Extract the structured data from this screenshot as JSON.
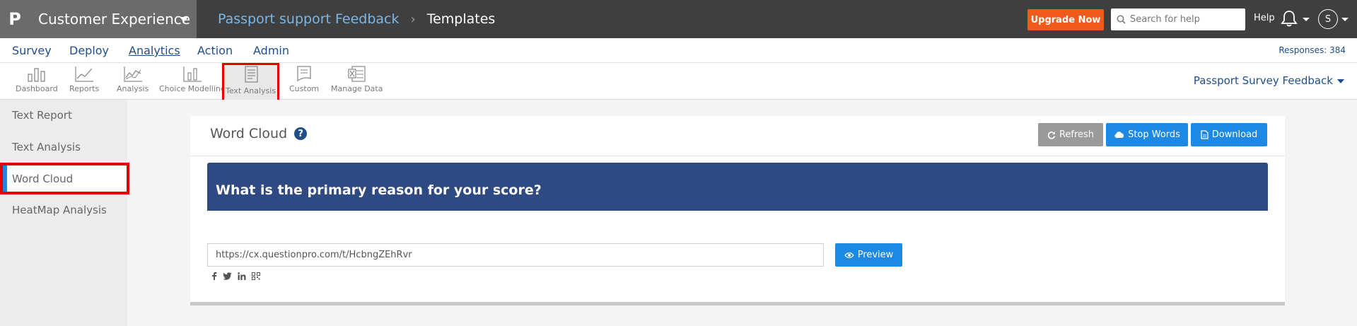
{
  "topbar": {
    "logo_letter": "P",
    "app_name": "Customer Experience",
    "breadcrumb_link": "Passport support Feedback",
    "breadcrumb_separator": "›",
    "breadcrumb_current": "Templates",
    "upgrade_label": "Upgrade Now",
    "search_placeholder": "Search for help",
    "help_label": "Help",
    "avatar_initial": "S"
  },
  "menu": {
    "items": [
      "Survey",
      "Deploy",
      "Analytics",
      "Action",
      "Admin"
    ],
    "active": "Analytics",
    "responses": "Responses: 384"
  },
  "toolbar": {
    "tools": [
      "Dashboard",
      "Reports",
      "Analysis",
      "Choice Modelling",
      "Text Analysis",
      "Custom",
      "Manage Data"
    ],
    "selected": "Text Analysis",
    "survey_selector": "Passport Survey Feedback"
  },
  "sidebar": {
    "items": [
      "Text Report",
      "Text Analysis",
      "Word Cloud",
      "HeatMap Analysis"
    ],
    "active": "Word Cloud"
  },
  "panel": {
    "title": "Word Cloud",
    "help_icon": "?",
    "refresh_label": "Refresh",
    "stop_words_label": "Stop Words",
    "download_label": "Download",
    "question": "What is the primary reason for your score?",
    "share_url": "https://cx.questionpro.com/t/HcbngZEhRvr",
    "preview_label": "Preview",
    "share_icons": [
      "facebook-icon",
      "twitter-icon",
      "linkedin-icon",
      "qr-code-icon"
    ]
  },
  "colors": {
    "topbar": "#3f3f3f",
    "brand_block": "#6b6b6b",
    "upgrade": "#f05a1a",
    "primary_blue": "#1e88e5",
    "question_bar": "#2f4a83",
    "highlight_red": "#e00000"
  }
}
